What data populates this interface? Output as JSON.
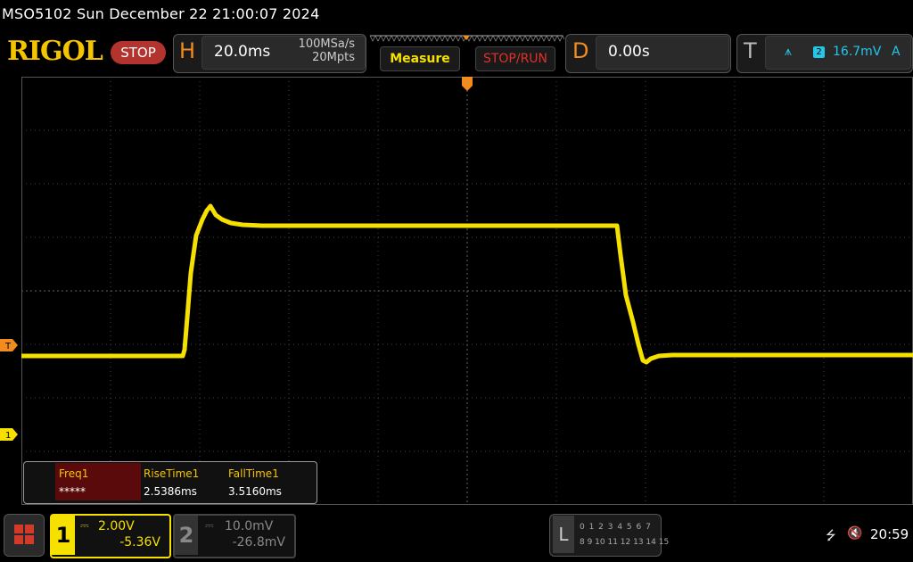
{
  "header": {
    "title": "MSO5102  Sun December 22 21:00:07 2024",
    "logo": "RIGOL",
    "status": "STOP"
  },
  "horizontal": {
    "letter": "H",
    "timebase": "20.0ms",
    "sample_rate": "100MSa/s",
    "memory_depth": "20Mpts"
  },
  "buttons": {
    "measure": "Measure",
    "stop_run": "STOP/RUN"
  },
  "delay": {
    "letter": "D",
    "value": "0.00s"
  },
  "trigger": {
    "letter": "T",
    "slope_icon": "rising-edge-icon",
    "source": "2",
    "level": "16.7mV",
    "mode": "A",
    "color": "#25c6e8"
  },
  "markers": {
    "trigger_marker": "T",
    "ch1_marker": "1"
  },
  "measurements": {
    "labels": [
      "Freq1",
      "RiseTime1",
      "FallTime1"
    ],
    "values": [
      "*****",
      "2.5386ms",
      "3.5160ms"
    ]
  },
  "channels": {
    "ch1": {
      "number": "1",
      "scale": "2.00V",
      "offset": "-5.36V",
      "color": "#f5e000"
    },
    "ch2": {
      "number": "2",
      "scale": "10.0mV",
      "offset": "-26.8mV",
      "color": "#888888"
    }
  },
  "logic_analyzer": {
    "letter": "L",
    "row1": "0 1 2 3  4 5 6 7",
    "row2": "8 9 10 11 12 13 14 15"
  },
  "status_bar": {
    "usb_icon": "usb-icon",
    "speaker_icon": "speaker-muted-icon",
    "clock": "20:59"
  },
  "colors": {
    "trace": "#f5e000",
    "accent_orange": "#f28c1e",
    "grid": "#555555"
  }
}
